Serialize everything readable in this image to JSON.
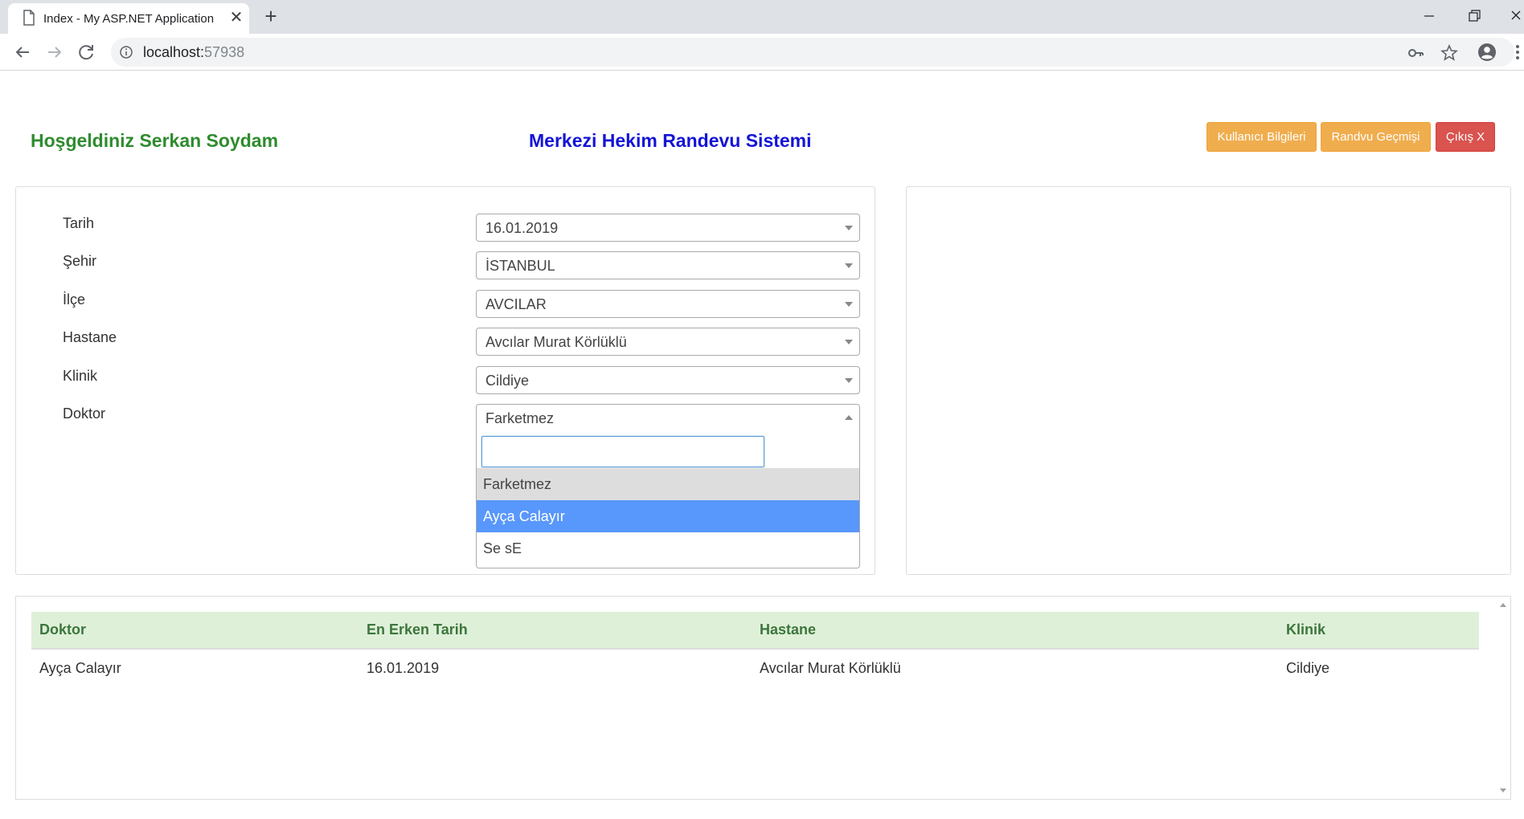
{
  "browser": {
    "tab_title": "Index - My ASP.NET Application",
    "url_host": "localhost:",
    "url_port": "57938"
  },
  "header": {
    "welcome": "Hoşgeldiniz Serkan Soydam",
    "title": "Merkezi Hekim Randevu Sistemi",
    "buttons": {
      "user_info": "Kullanıcı Bilgileri",
      "history": "Randvu Geçmişi",
      "logout": "Çıkış X"
    }
  },
  "form": {
    "date": {
      "label": "Tarih",
      "value": "16.01.2019"
    },
    "city": {
      "label": "Şehir",
      "value": "İSTANBUL"
    },
    "district": {
      "label": "İlçe",
      "value": "AVCILAR"
    },
    "hospital": {
      "label": "Hastane",
      "value": "Avcılar Murat Körlüklü"
    },
    "clinic": {
      "label": "Klinik",
      "value": "Cildiye"
    },
    "doctor": {
      "label": "Doktor",
      "value": "Farketmez",
      "search_value": "",
      "options": [
        "Farketmez",
        "Ayça Calayır",
        "Se sE"
      ]
    }
  },
  "results": {
    "headers": [
      "Doktor",
      "En Erken Tarih",
      "Hastane",
      "Klinik"
    ],
    "rows": [
      [
        "Ayça Calayır",
        "16.01.2019",
        "Avcılar Murat Körlüklü",
        "Cildiye"
      ]
    ]
  },
  "icons": {
    "tab": "document-icon",
    "back": "arrow-left-icon",
    "forward": "arrow-right-icon",
    "reload": "reload-icon",
    "info": "info-icon",
    "key": "key-icon",
    "star": "star-icon",
    "account": "account-icon",
    "menu": "kebab-menu-icon"
  },
  "colors": {
    "welcome": "#2e8b2e",
    "title": "#1414d6",
    "warning_button": "#f0ad4e",
    "danger_button": "#d9534f",
    "option_highlight": "#5897fb",
    "table_header_bg": "#dff0d8",
    "table_header_text": "#3c763d"
  }
}
